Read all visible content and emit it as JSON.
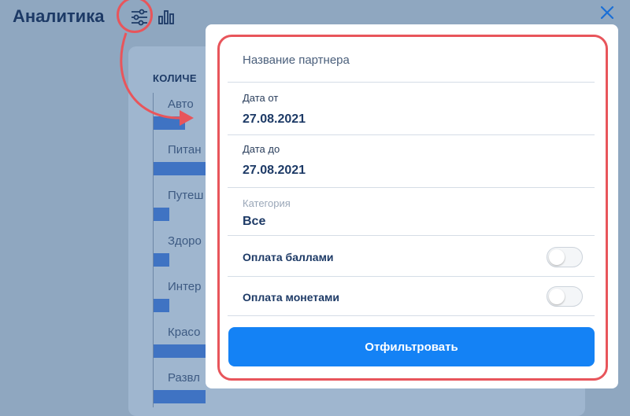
{
  "header": {
    "title": "Аналитика"
  },
  "background": {
    "section_title": "КОЛИЧЕ",
    "categories": [
      {
        "label": "Авто",
        "bar": 0.6
      },
      {
        "label": "Питан",
        "bar": 1.0
      },
      {
        "label": "Путеш",
        "bar": 0.3
      },
      {
        "label": "Здоро",
        "bar": 0.3
      },
      {
        "label": "Интер",
        "bar": 0.3
      },
      {
        "label": "Красо",
        "bar": 1.0
      },
      {
        "label": "Развл",
        "bar": 1.0
      }
    ]
  },
  "filter": {
    "partner_placeholder": "Название партнера",
    "date_from_label": "Дата от",
    "date_from_value": "27.08.2021",
    "date_to_label": "Дата до",
    "date_to_value": "27.08.2021",
    "category_label": "Категория",
    "category_value": "Все",
    "pay_points_label": "Оплата баллами",
    "pay_points_on": false,
    "pay_coins_label": "Оплата монетами",
    "pay_coins_on": false,
    "submit_label": "Отфильтровать"
  },
  "colors": {
    "accent": "#1482f5",
    "highlight": "#e8555b",
    "title": "#1d3a66"
  }
}
